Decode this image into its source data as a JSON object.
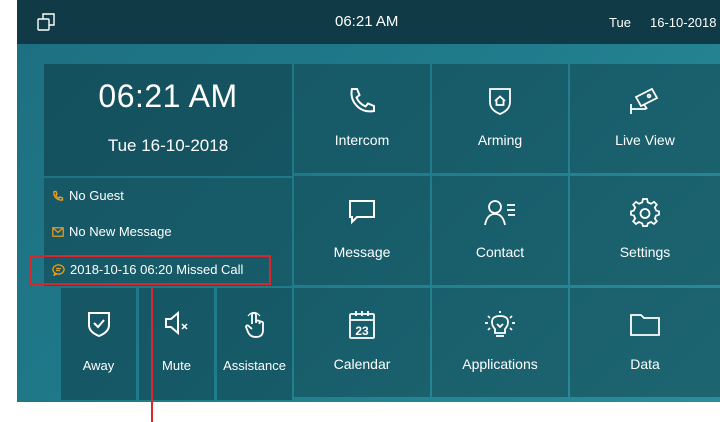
{
  "statusbar": {
    "time": "06:21 AM",
    "day": "Tue",
    "date": "16-10-2018"
  },
  "clock": {
    "time": "06:21 AM",
    "date": "Tue 16-10-2018"
  },
  "info": {
    "guest": "No Guest",
    "message": "No New Message",
    "missed_call": "2018-10-16 06:20 Missed Call"
  },
  "quick_actions": [
    {
      "label": "Away",
      "icon": "shield-check-icon"
    },
    {
      "label": "Mute",
      "icon": "speaker-mute-icon"
    },
    {
      "label": "Assistance",
      "icon": "hand-pointer-icon"
    }
  ],
  "tiles": [
    {
      "label": "Intercom",
      "icon": "phone-icon"
    },
    {
      "label": "Arming",
      "icon": "home-shield-icon"
    },
    {
      "label": "Live View",
      "icon": "camera-icon"
    },
    {
      "label": "Message",
      "icon": "message-icon"
    },
    {
      "label": "Contact",
      "icon": "contact-icon"
    },
    {
      "label": "Settings",
      "icon": "gear-icon"
    },
    {
      "label": "Calendar",
      "icon": "calendar-icon"
    },
    {
      "label": "Applications",
      "icon": "lightbulb-icon"
    },
    {
      "label": "Data",
      "icon": "folder-icon"
    }
  ],
  "calendar_day": "23",
  "colors": {
    "accent": "#f0a020",
    "highlight": "#d9262c",
    "statusbar": "#0f3a46"
  }
}
